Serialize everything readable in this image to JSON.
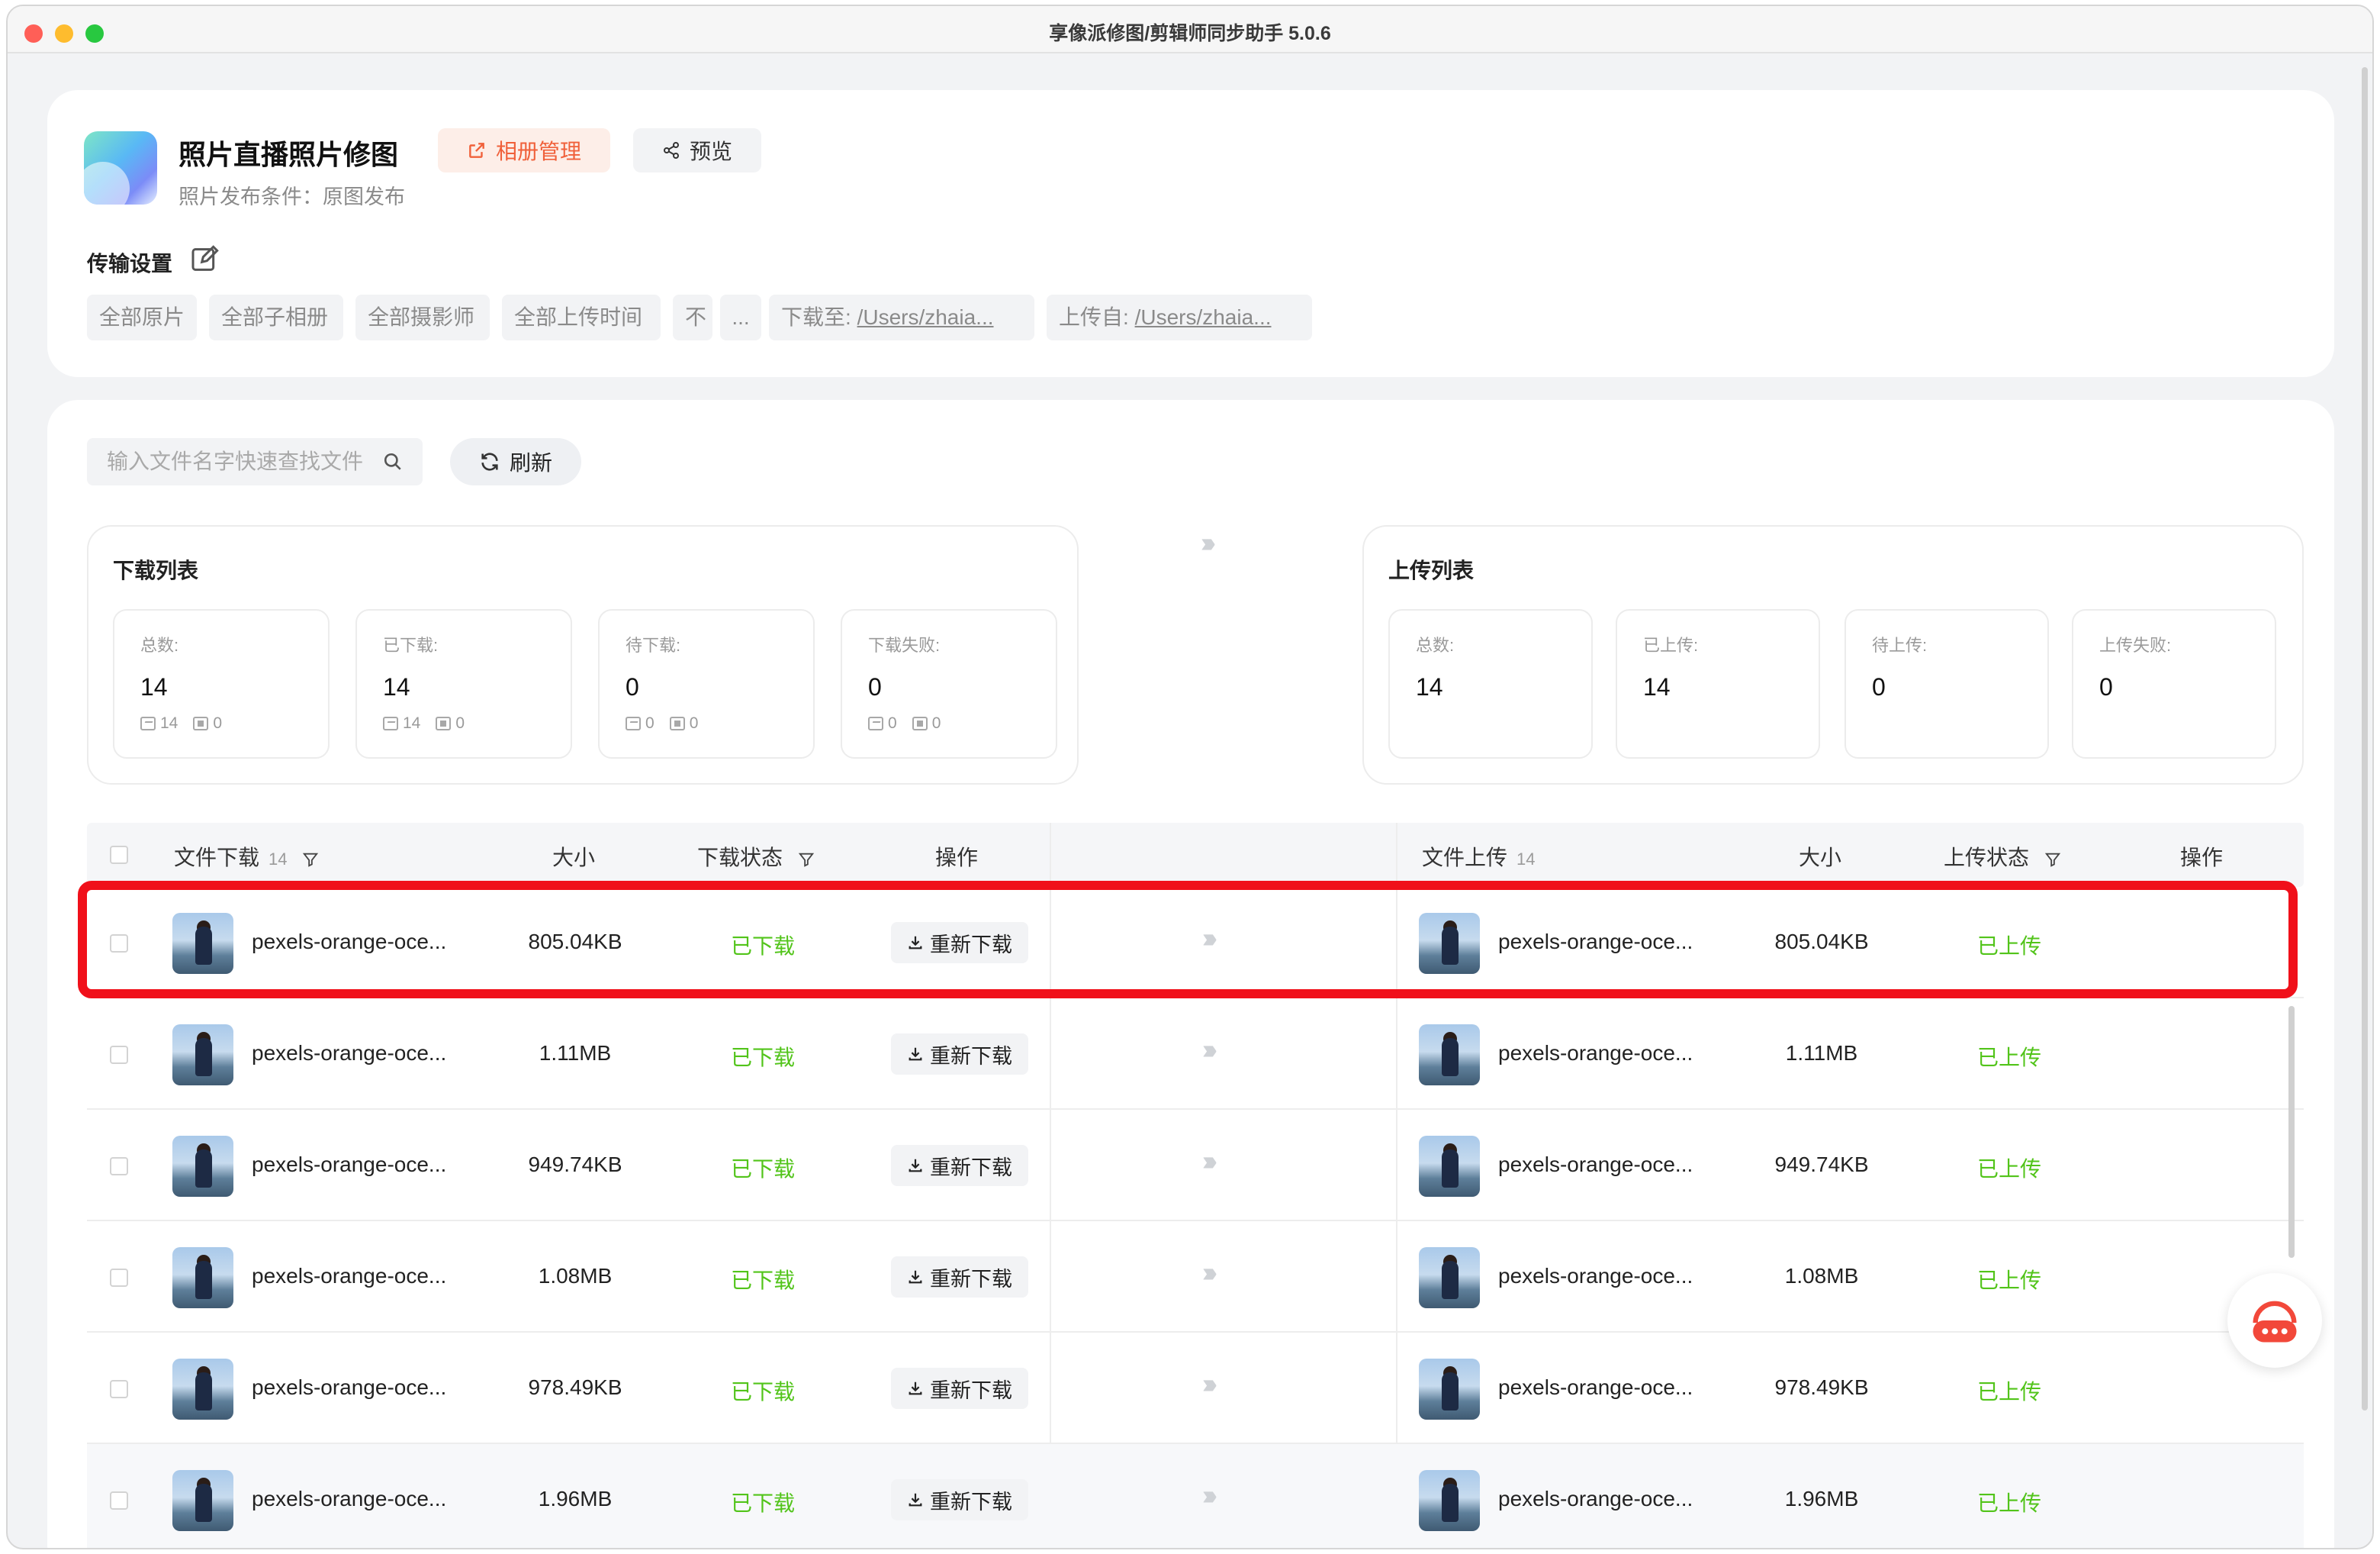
{
  "window": {
    "title": "享像派修图/剪辑师同步助手 5.0.6"
  },
  "header": {
    "app_name": "照片直播照片修图",
    "album_button": "相册管理",
    "preview_button": "预览",
    "publish_condition": "照片发布条件：原图发布"
  },
  "transfer": {
    "title": "传输设置",
    "chips": [
      "全部原片",
      "全部子相册",
      "全部摄影师",
      "全部上传时间",
      "不",
      "...",
      "下载至:",
      "/Users/zhaia...",
      "上传自:",
      "/Users/zhaia..."
    ]
  },
  "toolbar": {
    "search_placeholder": "输入文件名字快速查找文件",
    "refresh_label": "刷新"
  },
  "download_panel": {
    "title": "下载列表",
    "stats": [
      {
        "label": "总数:",
        "value": "14",
        "img": "14",
        "vid": "0"
      },
      {
        "label": "已下载:",
        "value": "14",
        "img": "14",
        "vid": "0"
      },
      {
        "label": "待下载:",
        "value": "0",
        "img": "0",
        "vid": "0"
      },
      {
        "label": "下载失败:",
        "value": "0",
        "img": "0",
        "vid": "0"
      }
    ]
  },
  "upload_panel": {
    "title": "上传列表",
    "stats": [
      {
        "label": "总数:",
        "value": "14"
      },
      {
        "label": "已上传:",
        "value": "14"
      },
      {
        "label": "待上传:",
        "value": "0"
      },
      {
        "label": "上传失败:",
        "value": "0"
      }
    ]
  },
  "table": {
    "headers": {
      "dl_file": "文件下载",
      "dl_count": "14",
      "dl_size": "大小",
      "dl_status": "下载状态",
      "dl_action": "操作",
      "ul_file": "文件上传",
      "ul_count": "14",
      "ul_size": "大小",
      "ul_status": "上传状态",
      "ul_action": "操作"
    },
    "rows": [
      {
        "dl_name": "pexels-orange-oce...",
        "dl_size": "805.04KB",
        "dl_status": "已下载",
        "action": "重新下载",
        "ul_name": "pexels-orange-oce...",
        "ul_size": "805.04KB",
        "ul_status": "已上传"
      },
      {
        "dl_name": "pexels-orange-oce...",
        "dl_size": "1.11MB",
        "dl_status": "已下载",
        "action": "重新下载",
        "ul_name": "pexels-orange-oce...",
        "ul_size": "1.11MB",
        "ul_status": "已上传"
      },
      {
        "dl_name": "pexels-orange-oce...",
        "dl_size": "949.74KB",
        "dl_status": "已下载",
        "action": "重新下载",
        "ul_name": "pexels-orange-oce...",
        "ul_size": "949.74KB",
        "ul_status": "已上传"
      },
      {
        "dl_name": "pexels-orange-oce...",
        "dl_size": "1.08MB",
        "dl_status": "已下载",
        "action": "重新下载",
        "ul_name": "pexels-orange-oce...",
        "ul_size": "1.08MB",
        "ul_status": "已上传"
      },
      {
        "dl_name": "pexels-orange-oce...",
        "dl_size": "978.49KB",
        "dl_status": "已下载",
        "action": "重新下载",
        "ul_name": "pexels-orange-oce...",
        "ul_size": "978.49KB",
        "ul_status": "已上传"
      },
      {
        "dl_name": "pexels-orange-oce...",
        "dl_size": "1.96MB",
        "dl_status": "已下载",
        "action": "重新下载",
        "ul_name": "pexels-orange-oce...",
        "ul_size": "1.96MB",
        "ul_status": "已上传"
      }
    ]
  },
  "colors": {
    "accent": "#f0603a",
    "success": "#52c41a",
    "highlight": "#f0101a"
  }
}
